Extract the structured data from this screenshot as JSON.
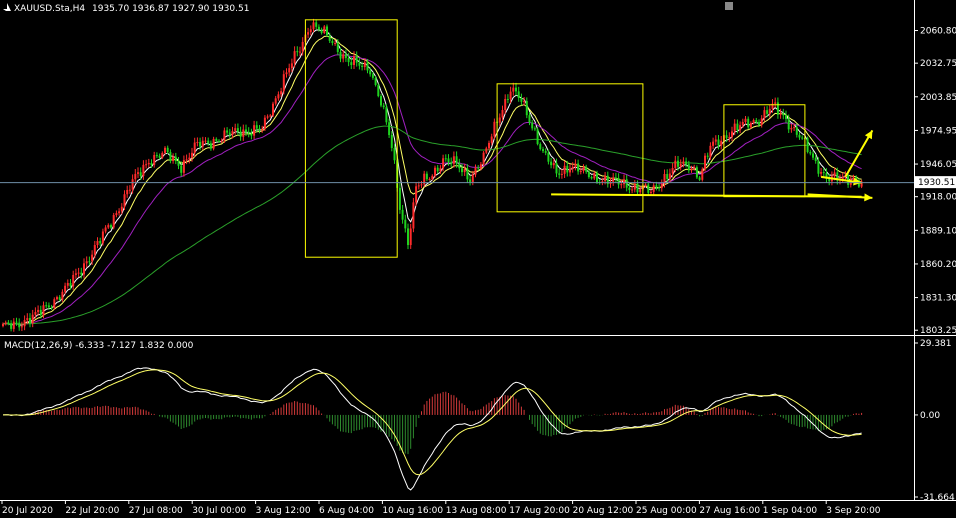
{
  "header": {
    "symbol_label": "XAUUSD.Sta,H4",
    "ohlc_label": "1935.70 1936.87 1927.90 1930.51"
  },
  "indicator": {
    "label": "MACD(12,26,9) -6.333 -7.127 1.832 0.000"
  },
  "icons": [
    "chart-type-icon"
  ],
  "colors": {
    "background": "#000000",
    "grid": "#ffffff",
    "bull": "#ff2b2b",
    "bear": "#1fd31f",
    "ema_fast": "#ffffff",
    "ema_mid": "#ffff66",
    "ema_slow": "#a020c0",
    "ema_long": "#2aa02a",
    "annotation": "#ffff00",
    "histogram_up": "#d43a3a",
    "histogram_down": "#2e8b2e",
    "macd_line": "#ffffff",
    "signal_line": "#ffff66"
  },
  "chart_data": [
    {
      "type": "candlestick",
      "title": "XAUUSD.Sta,H4",
      "current_price": 1930.51,
      "ylim": [
        1800,
        2075
      ],
      "y_ticks": [
        "2060.80",
        "2032.75",
        "2003.85",
        "1974.95",
        "1946.05",
        "1930.51",
        "1918.00",
        "1889.10",
        "1860.20",
        "1831.30",
        "1803.25"
      ],
      "x_ticks": [
        "20 Jul 2020",
        "22 Jul 20:00",
        "27 Jul 08:00",
        "30 Jul 00:00",
        "3 Aug 12:00",
        "6 Aug 04:00",
        "10 Aug 16:00",
        "13 Aug 08:00",
        "17 Aug 20:00",
        "20 Aug 12:00",
        "25 Aug 00:00",
        "27 Aug 16:00",
        "1 Sep 04:00",
        "3 Sep 20:00"
      ],
      "price_path": [
        [
          0,
          1805
        ],
        [
          12,
          1815
        ],
        [
          24,
          1840
        ],
        [
          36,
          1880
        ],
        [
          48,
          1930
        ],
        [
          54,
          1950
        ],
        [
          60,
          1955
        ],
        [
          66,
          1945
        ],
        [
          72,
          1962
        ],
        [
          80,
          1968
        ],
        [
          88,
          1975
        ],
        [
          96,
          1975
        ],
        [
          104,
          2020
        ],
        [
          110,
          2045
        ],
        [
          114,
          2068
        ],
        [
          118,
          2060
        ],
        [
          122,
          2050
        ],
        [
          128,
          2035
        ],
        [
          132,
          2030
        ],
        [
          136,
          2028
        ],
        [
          140,
          2000
        ],
        [
          144,
          1960
        ],
        [
          147,
          1910
        ],
        [
          150,
          1880
        ],
        [
          153,
          1925
        ],
        [
          158,
          1935
        ],
        [
          163,
          1950
        ],
        [
          168,
          1945
        ],
        [
          173,
          1935
        ],
        [
          178,
          1950
        ],
        [
          183,
          1985
        ],
        [
          188,
          2010
        ],
        [
          192,
          2000
        ],
        [
          196,
          1980
        ],
        [
          200,
          1955
        ],
        [
          205,
          1938
        ],
        [
          210,
          1945
        ],
        [
          215,
          1938
        ],
        [
          220,
          1935
        ],
        [
          225,
          1930
        ],
        [
          230,
          1930
        ],
        [
          235,
          1925
        ],
        [
          240,
          1922
        ],
        [
          245,
          1935
        ],
        [
          250,
          1945
        ],
        [
          255,
          1945
        ],
        [
          258,
          1935
        ],
        [
          262,
          1960
        ],
        [
          266,
          1968
        ],
        [
          270,
          1975
        ],
        [
          275,
          1980
        ],
        [
          280,
          1985
        ],
        [
          285,
          1995
        ],
        [
          290,
          1985
        ],
        [
          295,
          1970
        ],
        [
          300,
          1950
        ],
        [
          305,
          1935
        ],
        [
          310,
          1932
        ],
        [
          315,
          1935
        ],
        [
          318,
          1930
        ]
      ],
      "moving_averages": [
        {
          "name": "fast",
          "smoothing": 0.35
        },
        {
          "name": "mid",
          "smoothing": 0.18
        },
        {
          "name": "slow",
          "smoothing": 0.08
        },
        {
          "name": "long",
          "smoothing": 0.018
        }
      ],
      "annotations": {
        "boxes": [
          {
            "bars": [
              112,
              146
            ],
            "price": [
              1866,
              2070
            ]
          },
          {
            "bars": [
              183,
              237
            ],
            "price": [
              1905,
              2015
            ]
          },
          {
            "bars": [
              267,
              297
            ],
            "price": [
              1918,
              1997
            ]
          }
        ],
        "support_line": {
          "from": [
            203,
            1920
          ],
          "to": [
            318,
            1918
          ]
        },
        "arrows": [
          {
            "from": [
              303,
              1935
            ],
            "to": [
              318,
              1930
            ]
          },
          {
            "from": [
              312,
              1935
            ],
            "to": [
              322,
              1975
            ]
          },
          {
            "from": [
              298,
              1920
            ],
            "to": [
              322,
              1917
            ]
          }
        ]
      }
    },
    {
      "type": "macd",
      "title": "MACD(12,26,9)",
      "values": {
        "macd": -6.333,
        "signal": -7.127,
        "histogram": 1.832,
        "zero": 0.0
      },
      "ylim": [
        -31.664,
        29.381
      ],
      "y_ticks": [
        "29.381",
        "0.00",
        "-31.664"
      ]
    }
  ]
}
